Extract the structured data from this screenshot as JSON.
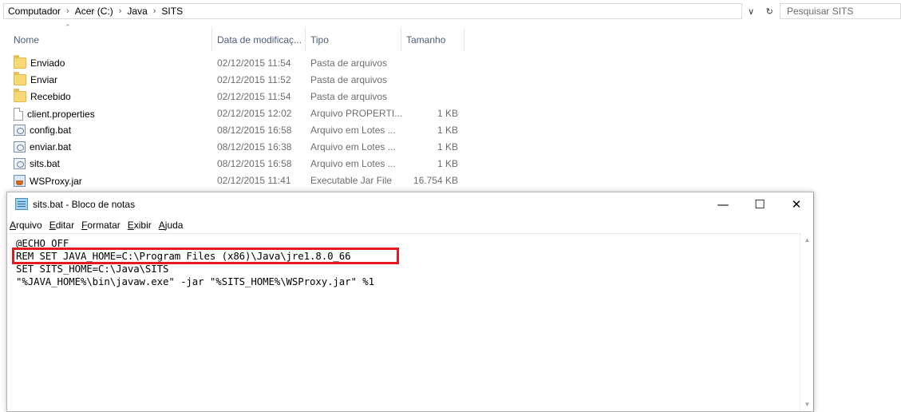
{
  "explorer": {
    "breadcrumb": [
      "Computador",
      "Acer (C:)",
      "Java",
      "SITS"
    ],
    "search_placeholder": "Pesquisar SITS",
    "columns": {
      "name": "Nome",
      "date": "Data de modificaç...",
      "type": "Tipo",
      "size": "Tamanho"
    },
    "files": [
      {
        "name": "Enviado",
        "date": "02/12/2015 11:54",
        "type": "Pasta de arquivos",
        "size": "",
        "icon": "folder-icon"
      },
      {
        "name": "Enviar",
        "date": "02/12/2015 11:52",
        "type": "Pasta de arquivos",
        "size": "",
        "icon": "folder-icon"
      },
      {
        "name": "Recebido",
        "date": "02/12/2015 11:54",
        "type": "Pasta de arquivos",
        "size": "",
        "icon": "folder-icon"
      },
      {
        "name": "client.properties",
        "date": "02/12/2015 12:02",
        "type": "Arquivo PROPERTI...",
        "size": "1 KB",
        "icon": "document-icon"
      },
      {
        "name": "config.bat",
        "date": "08/12/2015 16:58",
        "type": "Arquivo em Lotes ...",
        "size": "1 KB",
        "icon": "batch-file-icon"
      },
      {
        "name": "enviar.bat",
        "date": "08/12/2015 16:38",
        "type": "Arquivo em Lotes ...",
        "size": "1 KB",
        "icon": "batch-file-icon"
      },
      {
        "name": "sits.bat",
        "date": "08/12/2015 16:58",
        "type": "Arquivo em Lotes ...",
        "size": "1 KB",
        "icon": "batch-file-icon"
      },
      {
        "name": "WSProxy.jar",
        "date": "02/12/2015 11:41",
        "type": "Executable Jar File",
        "size": "16.754 KB",
        "icon": "java-jar-icon"
      }
    ]
  },
  "notepad": {
    "title": "sits.bat - Bloco de notas",
    "menu": [
      "Arquivo",
      "Editar",
      "Formatar",
      "Exibir",
      "Ajuda"
    ],
    "lines": [
      "@ECHO OFF",
      "REM SET JAVA_HOME=C:\\Program Files (x86)\\Java\\jre1.8.0_66",
      "SET SITS_HOME=C:\\Java\\SITS",
      "\"%JAVA_HOME%\\bin\\javaw.exe\" -jar \"%SITS_HOME%\\WSProxy.jar\" %1"
    ],
    "highlight_color": "#e21a22"
  }
}
